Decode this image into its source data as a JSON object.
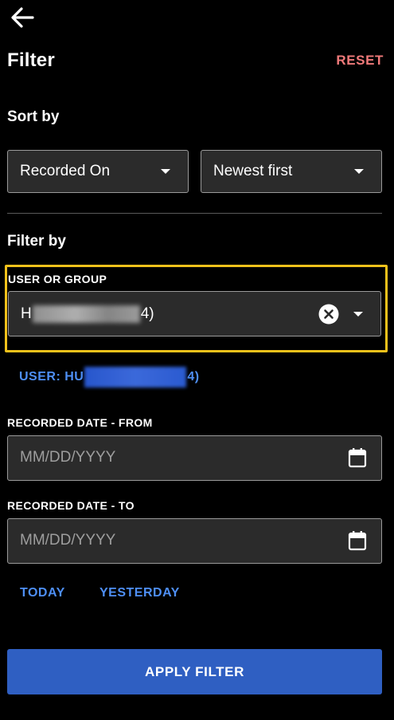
{
  "header": {
    "title": "Filter",
    "reset_label": "RESET",
    "back_icon": "arrow-left-icon"
  },
  "sort": {
    "heading": "Sort by",
    "field_value": "Recorded On",
    "order_value": "Newest first"
  },
  "filter": {
    "heading": "Filter by",
    "user_group_label": "USER OR GROUP",
    "user_group_prefix": "H",
    "user_group_suffix": "4)",
    "selected_prefix": "USER: HU",
    "selected_suffix": "4)",
    "date_from_label": "RECORDED DATE - FROM",
    "date_from_placeholder": "MM/DD/YYYY",
    "date_to_label": "RECORDED DATE - TO",
    "date_to_placeholder": "MM/DD/YYYY",
    "today_label": "TODAY",
    "yesterday_label": "YESTERDAY"
  },
  "footer": {
    "apply_label": "APPLY FILTER"
  },
  "colors": {
    "background": "#000000",
    "reset": "#f07a7a",
    "link": "#4e8ff5",
    "apply_button": "#2f5fc2",
    "highlight": "#f2c21b",
    "field_bg": "#2b2b2b"
  }
}
